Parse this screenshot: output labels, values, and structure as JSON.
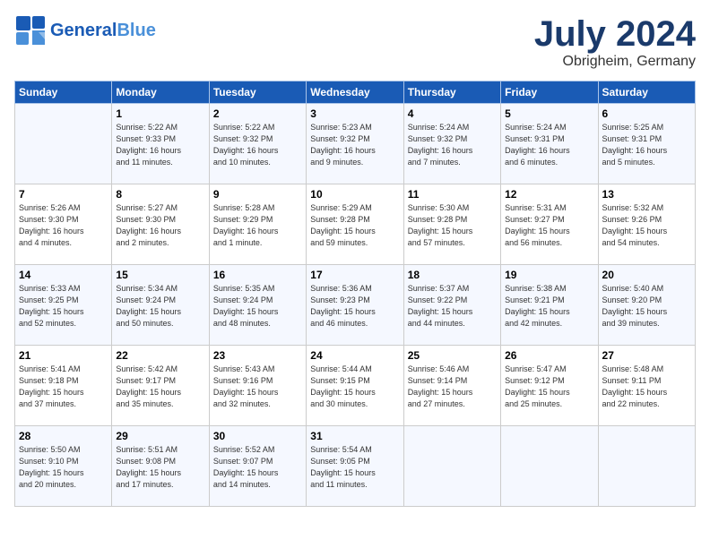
{
  "header": {
    "logo_general": "General",
    "logo_blue": "Blue",
    "month": "July 2024",
    "location": "Obrigheim, Germany"
  },
  "weekdays": [
    "Sunday",
    "Monday",
    "Tuesday",
    "Wednesday",
    "Thursday",
    "Friday",
    "Saturday"
  ],
  "weeks": [
    [
      {
        "day": "",
        "info": ""
      },
      {
        "day": "1",
        "info": "Sunrise: 5:22 AM\nSunset: 9:33 PM\nDaylight: 16 hours\nand 11 minutes."
      },
      {
        "day": "2",
        "info": "Sunrise: 5:22 AM\nSunset: 9:32 PM\nDaylight: 16 hours\nand 10 minutes."
      },
      {
        "day": "3",
        "info": "Sunrise: 5:23 AM\nSunset: 9:32 PM\nDaylight: 16 hours\nand 9 minutes."
      },
      {
        "day": "4",
        "info": "Sunrise: 5:24 AM\nSunset: 9:32 PM\nDaylight: 16 hours\nand 7 minutes."
      },
      {
        "day": "5",
        "info": "Sunrise: 5:24 AM\nSunset: 9:31 PM\nDaylight: 16 hours\nand 6 minutes."
      },
      {
        "day": "6",
        "info": "Sunrise: 5:25 AM\nSunset: 9:31 PM\nDaylight: 16 hours\nand 5 minutes."
      }
    ],
    [
      {
        "day": "7",
        "info": "Sunrise: 5:26 AM\nSunset: 9:30 PM\nDaylight: 16 hours\nand 4 minutes."
      },
      {
        "day": "8",
        "info": "Sunrise: 5:27 AM\nSunset: 9:30 PM\nDaylight: 16 hours\nand 2 minutes."
      },
      {
        "day": "9",
        "info": "Sunrise: 5:28 AM\nSunset: 9:29 PM\nDaylight: 16 hours\nand 1 minute."
      },
      {
        "day": "10",
        "info": "Sunrise: 5:29 AM\nSunset: 9:28 PM\nDaylight: 15 hours\nand 59 minutes."
      },
      {
        "day": "11",
        "info": "Sunrise: 5:30 AM\nSunset: 9:28 PM\nDaylight: 15 hours\nand 57 minutes."
      },
      {
        "day": "12",
        "info": "Sunrise: 5:31 AM\nSunset: 9:27 PM\nDaylight: 15 hours\nand 56 minutes."
      },
      {
        "day": "13",
        "info": "Sunrise: 5:32 AM\nSunset: 9:26 PM\nDaylight: 15 hours\nand 54 minutes."
      }
    ],
    [
      {
        "day": "14",
        "info": "Sunrise: 5:33 AM\nSunset: 9:25 PM\nDaylight: 15 hours\nand 52 minutes."
      },
      {
        "day": "15",
        "info": "Sunrise: 5:34 AM\nSunset: 9:24 PM\nDaylight: 15 hours\nand 50 minutes."
      },
      {
        "day": "16",
        "info": "Sunrise: 5:35 AM\nSunset: 9:24 PM\nDaylight: 15 hours\nand 48 minutes."
      },
      {
        "day": "17",
        "info": "Sunrise: 5:36 AM\nSunset: 9:23 PM\nDaylight: 15 hours\nand 46 minutes."
      },
      {
        "day": "18",
        "info": "Sunrise: 5:37 AM\nSunset: 9:22 PM\nDaylight: 15 hours\nand 44 minutes."
      },
      {
        "day": "19",
        "info": "Sunrise: 5:38 AM\nSunset: 9:21 PM\nDaylight: 15 hours\nand 42 minutes."
      },
      {
        "day": "20",
        "info": "Sunrise: 5:40 AM\nSunset: 9:20 PM\nDaylight: 15 hours\nand 39 minutes."
      }
    ],
    [
      {
        "day": "21",
        "info": "Sunrise: 5:41 AM\nSunset: 9:18 PM\nDaylight: 15 hours\nand 37 minutes."
      },
      {
        "day": "22",
        "info": "Sunrise: 5:42 AM\nSunset: 9:17 PM\nDaylight: 15 hours\nand 35 minutes."
      },
      {
        "day": "23",
        "info": "Sunrise: 5:43 AM\nSunset: 9:16 PM\nDaylight: 15 hours\nand 32 minutes."
      },
      {
        "day": "24",
        "info": "Sunrise: 5:44 AM\nSunset: 9:15 PM\nDaylight: 15 hours\nand 30 minutes."
      },
      {
        "day": "25",
        "info": "Sunrise: 5:46 AM\nSunset: 9:14 PM\nDaylight: 15 hours\nand 27 minutes."
      },
      {
        "day": "26",
        "info": "Sunrise: 5:47 AM\nSunset: 9:12 PM\nDaylight: 15 hours\nand 25 minutes."
      },
      {
        "day": "27",
        "info": "Sunrise: 5:48 AM\nSunset: 9:11 PM\nDaylight: 15 hours\nand 22 minutes."
      }
    ],
    [
      {
        "day": "28",
        "info": "Sunrise: 5:50 AM\nSunset: 9:10 PM\nDaylight: 15 hours\nand 20 minutes."
      },
      {
        "day": "29",
        "info": "Sunrise: 5:51 AM\nSunset: 9:08 PM\nDaylight: 15 hours\nand 17 minutes."
      },
      {
        "day": "30",
        "info": "Sunrise: 5:52 AM\nSunset: 9:07 PM\nDaylight: 15 hours\nand 14 minutes."
      },
      {
        "day": "31",
        "info": "Sunrise: 5:54 AM\nSunset: 9:05 PM\nDaylight: 15 hours\nand 11 minutes."
      },
      {
        "day": "",
        "info": ""
      },
      {
        "day": "",
        "info": ""
      },
      {
        "day": "",
        "info": ""
      }
    ]
  ]
}
